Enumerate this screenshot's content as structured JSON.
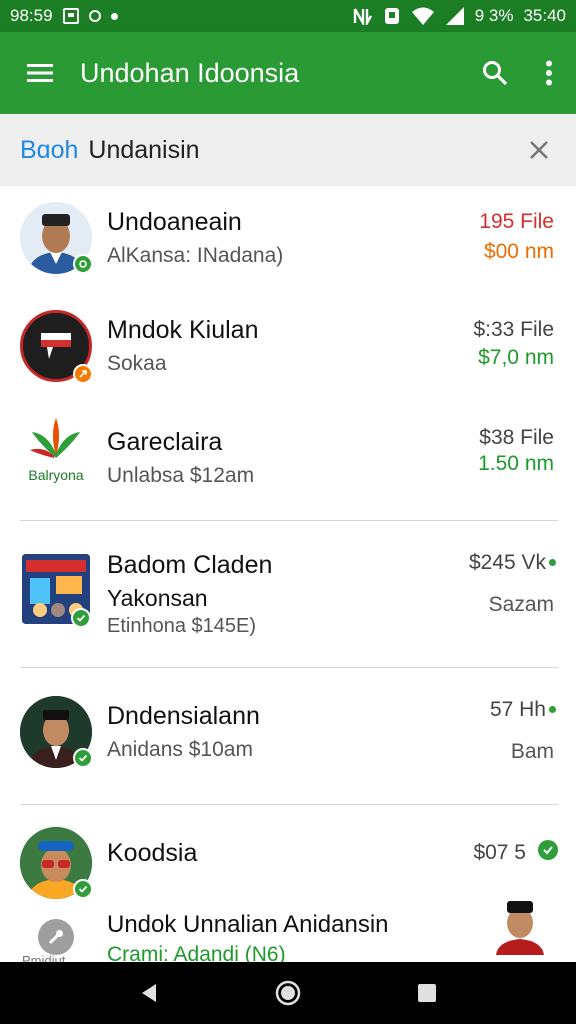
{
  "status_bar": {
    "time": "98:59",
    "battery": "9 3%",
    "clock_right": "35:40"
  },
  "app_bar": {
    "title": "Undohan Idoonsia"
  },
  "search": {
    "query_highlight": "Bɑoh",
    "query": "Undanisin"
  },
  "items": [
    {
      "name": "Undoaneain",
      "sub": "AlKansa: INadana)",
      "right1": "195 File",
      "right2": "$00 nm",
      "right1_color": "#d32f2f",
      "right2_color": "#ef6c00",
      "badge_color": "#2e9e3a"
    },
    {
      "name": "Mndok Kiulan",
      "sub": "Sokaa",
      "right1": "$:33 File",
      "right2": "$7,0 nm",
      "right1_color": "#444444",
      "right2_color": "#1e9a2a",
      "badge_color": "#f57c00"
    },
    {
      "name": "Gareclaira",
      "sub": "Unlabsa $12am",
      "right1": "$38 File",
      "right2": "1.50 nm",
      "right1_color": "#444444",
      "right2_color": "#1e9a2a",
      "logo_text": "Balryona"
    },
    {
      "name": "Badom Claden",
      "name2": "Yakonsan",
      "sub": "Etinhona $145E)",
      "right1": "$245 Vk",
      "right2": "Sazam",
      "right1_color": "#444444",
      "right2_color": "#555555",
      "badge_color": "#2e9e3a"
    },
    {
      "name": "Dndensialann",
      "sub": "Anidans $10am",
      "right1": "57 Hh",
      "right2": "Bam",
      "right1_color": "#444444",
      "right2_color": "#555555",
      "badge_color": "#2e9e3a"
    },
    {
      "name": "Koodsia",
      "right1": "$07 5",
      "right1_color": "#444444",
      "badge_color": "#2e9e3a"
    },
    {
      "name": "Undok Unnalian Anidansin",
      "sub": "Crami: Adandi (N6)",
      "left_label": "Pmidiut",
      "sub_color": "#1e9a2a"
    }
  ],
  "colors": {
    "status_bar": "#1b7d24",
    "app_bar": "#2a9a35",
    "accent_blue": "#1e88e5",
    "green": "#2e9e3a"
  },
  "icons": [
    "menu-icon",
    "search-icon",
    "more-vert-icon",
    "close-icon",
    "check-icon",
    "back-icon",
    "home-icon",
    "recents-icon"
  ]
}
